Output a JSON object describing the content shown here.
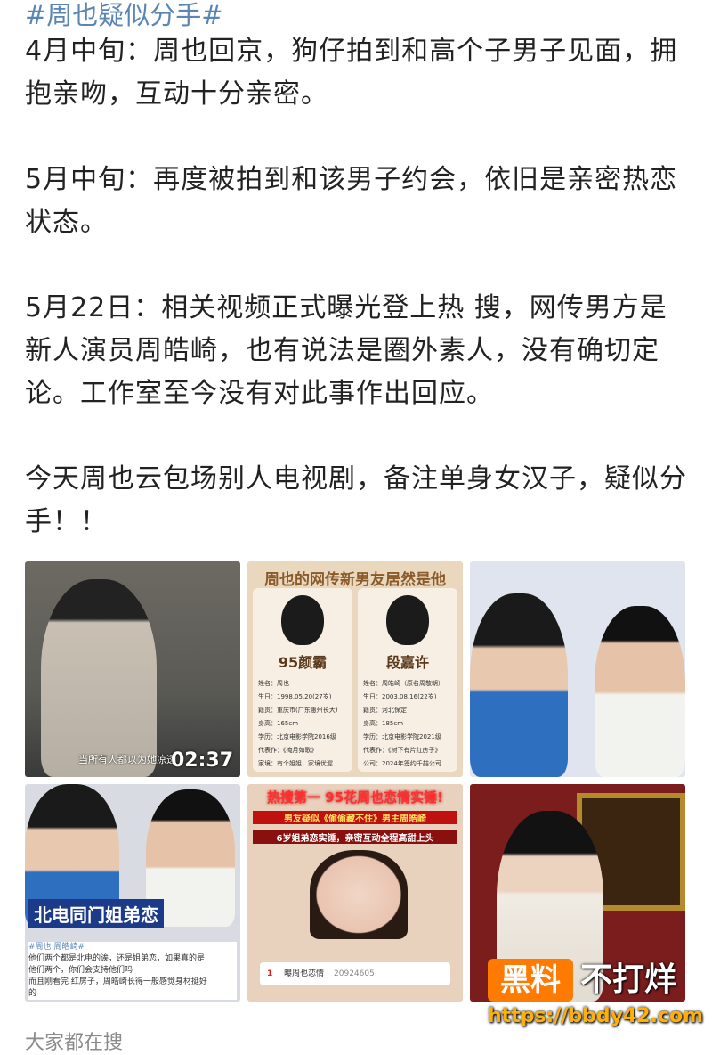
{
  "post": {
    "hashtag": "#周也疑似分手#",
    "paragraphs": [
      "4月中旬：周也回京，狗仔拍到和高个子男子见面，拥抱亲吻，互动十分亲密。",
      "5月中旬：再度被拍到和该男子约会，依旧是亲密热恋状态。",
      "5月22日：相关视频正式曝光登上热 搜，网传男方是新人演员周皓崎，也有说法是圈外素人，没有确切定论。工作室至今没有对此事作出回应。",
      "今天周也云包场别人电视剧，备注单身女汉子，疑似分手！！"
    ]
  },
  "images": {
    "img1": {
      "subtitle": "当所有人都以为她凉透",
      "timer": "02:37"
    },
    "img2": {
      "title": "周也的网传新男友居然是他",
      "left_name": "95颜霸",
      "right_name": "段嘉许",
      "left_info": [
        "姓名：周也",
        "生日：1998.05.20(27岁)",
        "籍贯：重庆市(广东惠州长大)",
        "身高：165cm",
        "学历：北京电影学院2016级",
        "代表作：《掩月如歌》",
        "家境：有个姐姐，家境优渥"
      ],
      "right_info": [
        "姓名：周皓崎（原名周敬朝）",
        "生日：2003.08.16(22岁)",
        "籍贯：河北保定",
        "身高：185cm",
        "学历：北京电影学院2021级",
        "代表作：《树下有片红房子》",
        "公司：2024年签约千喆公司"
      ]
    },
    "img4": {
      "banner": "北电同门姐弟恋",
      "note_lines": [
        "#周也 周皓崎#",
        "他们两个都是北电的诶，还是姐弟恋，如果真的是",
        "他们两个，你们会支持他们吗",
        "而且刚看完 红房子，周皓崎长得一般感觉身材挺好",
        "的"
      ]
    },
    "img5": {
      "title_line1": "热搜第一 95花周也恋情实锤!",
      "title_line2": "男友疑似《偷偷藏不住》男主周皓崎",
      "bar": "6岁姐弟恋实锤，亲密互动全程高甜上头",
      "search_rank": "1",
      "search_text": "曝周也恋情",
      "search_count": "20924605"
    }
  },
  "watermark": {
    "logo": "黑料",
    "text": "不打烊",
    "url": "https://bbdy42.com"
  },
  "footer": {
    "label": "大家都在搜"
  }
}
